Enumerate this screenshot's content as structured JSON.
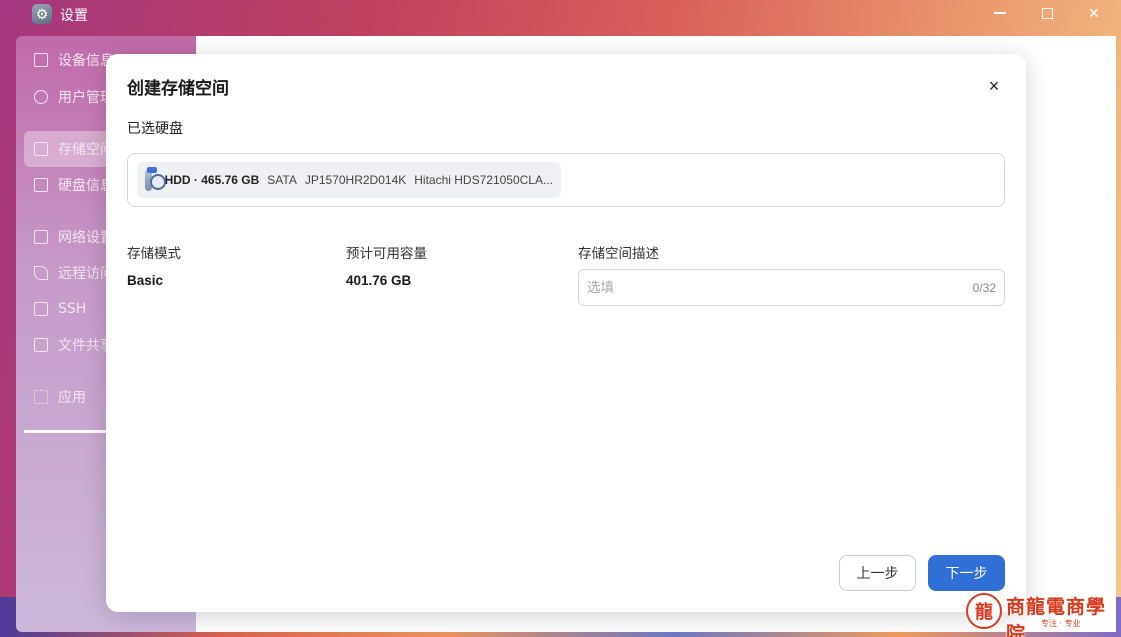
{
  "window": {
    "title": "设置",
    "minimize_label": "—",
    "close_label": "✕"
  },
  "sidebar": {
    "items": [
      {
        "label": "设备信息"
      },
      {
        "label": "用户管理"
      },
      {
        "label": "存储空间"
      },
      {
        "label": "硬盘信息"
      },
      {
        "label": "网络设置"
      },
      {
        "label": "远程访问"
      },
      {
        "label": "SSH"
      },
      {
        "label": "文件共享"
      },
      {
        "label": "应用"
      }
    ]
  },
  "dialog": {
    "title": "创建存储空间",
    "close_label": "×",
    "selected_disks_label": "已选硬盘",
    "disk": {
      "main": "HDD · 465.76 GB",
      "interface": "SATA",
      "serial": "JP1570HR2D014K",
      "model": "Hitachi HDS721050CLA..."
    },
    "storage_mode": {
      "label": "存储模式",
      "value": "Basic"
    },
    "capacity": {
      "label": "预计可用容量",
      "value": "401.76 GB"
    },
    "description": {
      "label": "存储空间描述",
      "placeholder": "选填",
      "count": "0/32"
    },
    "prev_button": "上一步",
    "next_button": "下一步"
  },
  "watermark": {
    "text": "商龍電商學院",
    "sub": "专注 · 专业"
  }
}
